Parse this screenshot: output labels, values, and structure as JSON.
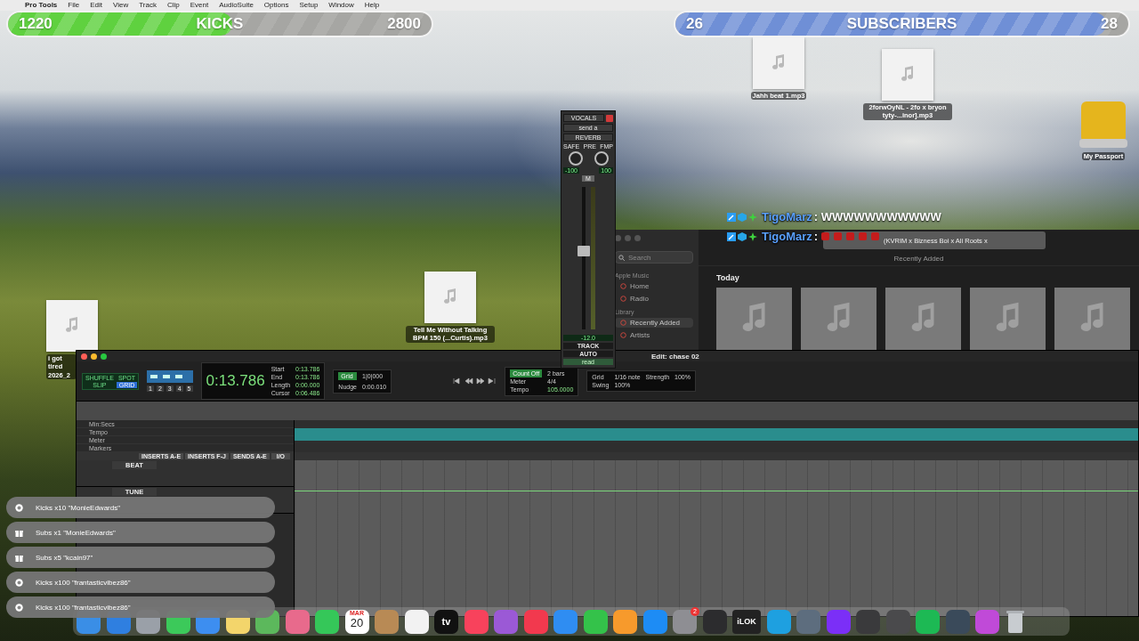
{
  "menu_bar": {
    "items": [
      "Pro Tools",
      "File",
      "Edit",
      "View",
      "Track",
      "Clip",
      "Event",
      "AudioSuite",
      "Options",
      "Setup",
      "Window",
      "Help"
    ]
  },
  "goals": [
    {
      "start": "1220",
      "label": "KICKS",
      "target": "2800",
      "level": 0.53,
      "color": "#5fd13f"
    },
    {
      "start": "26",
      "label": "SUBSCRIBERS",
      "target": "28",
      "level": 0.95,
      "color": "#6f8fd6"
    }
  ],
  "desktop_icons": [
    {
      "kind": "audio",
      "label": "Jahh beat 1.mp3"
    },
    {
      "kind": "audio",
      "label": "2forwOyNL - 2fo x bryon tyty-...inor].mp3"
    },
    {
      "kind": "drive",
      "label": "My Passport"
    },
    {
      "kind": "audio",
      "label": "Tell Me Without Talking BPM 150 (...Curtis).mp3"
    },
    {
      "kind": "audio",
      "label": "i got tired 2026_2"
    }
  ],
  "chat": [
    {
      "kind": "text",
      "user": "TigoMarz",
      "message": ": WWWWWWWWWWW"
    },
    {
      "kind": "emotes",
      "user": "TigoMarz",
      "message": ":"
    }
  ],
  "music_app": {
    "now_playing": "(KVRIM x Bizness Boi x Ali Roots x",
    "search": {
      "placeholder": "Search"
    },
    "sidebar": [
      {
        "heading": "Apple Music",
        "items": [
          {
            "label": "Home",
            "selected": false
          },
          {
            "label": "Radio",
            "selected": false
          }
        ]
      },
      {
        "heading": "Library",
        "items": [
          {
            "label": "Recently Added",
            "selected": true
          },
          {
            "label": "Artists",
            "selected": false
          }
        ]
      }
    ],
    "header": "Recently Added",
    "section": "Today"
  },
  "mixer": {
    "track_name": "VOCALS",
    "send": "send a",
    "insert": "REVERB",
    "buttons": [
      "SAFE",
      "PRE",
      "FMP"
    ],
    "pan": [
      "-100",
      "100"
    ],
    "mute": "M",
    "level": 0.55,
    "volume": "-12.0",
    "footer": [
      "TRACK",
      "AUTO"
    ],
    "auto_mode": "read"
  },
  "pro_tools": {
    "title": "Edit: chase 02",
    "edit_modes": [
      {
        "label": "SHUFFLE",
        "selected": false
      },
      {
        "label": "SPOT",
        "selected": false
      },
      {
        "label": "SLIP",
        "selected": false
      },
      {
        "label": "GRID",
        "selected": true
      }
    ],
    "zoom_presets": [
      "1",
      "2",
      "3",
      "4",
      "5"
    ],
    "main_counter": "0:13.786",
    "selection": [
      {
        "label": "Start",
        "value": "0:13.786"
      },
      {
        "label": "End",
        "value": "0:13.786"
      },
      {
        "label": "Length",
        "value": "0:00.000"
      }
    ],
    "cursor": {
      "label": "Cursor",
      "value": "0:06.486"
    },
    "grid": {
      "label": "Grid",
      "value": "1|0|000"
    },
    "nudge": {
      "label": "Nudge",
      "value": "0:00.010"
    },
    "count_off": {
      "label": "Count Off",
      "value": "2 bars"
    },
    "meter": {
      "label": "Meter",
      "value": "4/4"
    },
    "tempo": {
      "label": "Tempo",
      "value": "105.0000"
    },
    "grid_settings": {
      "label": "Grid",
      "value": "1/16 note"
    },
    "strength": {
      "label": "Strength",
      "value": "100%"
    },
    "swing": {
      "label": "Swing",
      "value": "100%"
    },
    "rulers": [
      "Min:Secs",
      "Tempo",
      "Meter",
      "Markers"
    ],
    "track_columns": [
      "INSERTS A-E",
      "INSERTS F-J",
      "SENDS A-E",
      "I/O"
    ],
    "tracks": [
      {
        "name": "BEAT"
      },
      {
        "name": "TUNE"
      }
    ]
  },
  "alerts": [
    {
      "kind": "kick",
      "text": "Kicks x10 \"MonieEdwards\""
    },
    {
      "kind": "gift",
      "text": "Subs x1 \"MonieEdwards\""
    },
    {
      "kind": "gift",
      "text": "Subs x5 \"kcain97\""
    },
    {
      "kind": "kick",
      "text": "Kicks x100 \"frantasticvibez86\""
    },
    {
      "kind": "kick",
      "text": "Kicks x100 \"frantasticvibez86\""
    }
  ],
  "dock": [
    {
      "kind": "app",
      "color": "#3a8ee6"
    },
    {
      "kind": "app",
      "color": "#2f7fe0"
    },
    {
      "kind": "app",
      "color": "#9aa0a8"
    },
    {
      "kind": "app",
      "color": "#3cc95a"
    },
    {
      "kind": "app",
      "color": "#3d8ef0"
    },
    {
      "kind": "app",
      "color": "#f3d56b"
    },
    {
      "kind": "app",
      "color": "#5cb85c"
    },
    {
      "kind": "app",
      "color": "#e86a8c"
    },
    {
      "kind": "app",
      "color": "#35c759"
    },
    {
      "kind": "calendar",
      "month": "MAR",
      "day": "20"
    },
    {
      "kind": "app",
      "color": "#b88a55"
    },
    {
      "kind": "app",
      "color": "#f2f2f2"
    },
    {
      "kind": "tv",
      "label": "tv"
    },
    {
      "kind": "app",
      "color": "#f8425c"
    },
    {
      "kind": "app",
      "color": "#9b59d6"
    },
    {
      "kind": "app",
      "color": "#f2394e"
    },
    {
      "kind": "app",
      "color": "#2f8df2"
    },
    {
      "kind": "app",
      "color": "#34c24a"
    },
    {
      "kind": "app",
      "color": "#f79a2c"
    },
    {
      "kind": "app",
      "color": "#1d8cf5"
    },
    {
      "kind": "app",
      "color": "#8e8e93",
      "badge": "2"
    },
    {
      "kind": "app",
      "color": "#2c2c2e"
    },
    {
      "kind": "label",
      "label": "iLOK"
    },
    {
      "kind": "app",
      "color": "#1ea0e0"
    },
    {
      "kind": "app",
      "color": "#5d6d7e"
    },
    {
      "kind": "app",
      "color": "#7b2ff7"
    },
    {
      "kind": "app",
      "color": "#3a3a3c"
    },
    {
      "kind": "app",
      "color": "#4a4a4c"
    },
    {
      "kind": "app",
      "color": "#1db954"
    },
    {
      "kind": "app",
      "color": "#3a4a5a"
    },
    {
      "kind": "app",
      "color": "#c04ad8"
    },
    {
      "kind": "trash"
    }
  ]
}
